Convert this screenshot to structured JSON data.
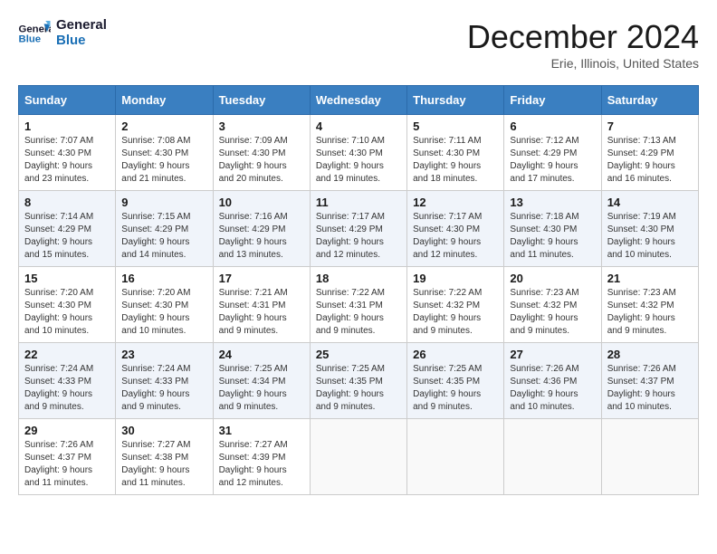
{
  "header": {
    "logo_line1": "General",
    "logo_line2": "Blue",
    "month_title": "December 2024",
    "location": "Erie, Illinois, United States"
  },
  "weekdays": [
    "Sunday",
    "Monday",
    "Tuesday",
    "Wednesday",
    "Thursday",
    "Friday",
    "Saturday"
  ],
  "weeks": [
    [
      {
        "day": "1",
        "sunrise": "7:07 AM",
        "sunset": "4:30 PM",
        "daylight": "9 hours and 23 minutes."
      },
      {
        "day": "2",
        "sunrise": "7:08 AM",
        "sunset": "4:30 PM",
        "daylight": "9 hours and 21 minutes."
      },
      {
        "day": "3",
        "sunrise": "7:09 AM",
        "sunset": "4:30 PM",
        "daylight": "9 hours and 20 minutes."
      },
      {
        "day": "4",
        "sunrise": "7:10 AM",
        "sunset": "4:30 PM",
        "daylight": "9 hours and 19 minutes."
      },
      {
        "day": "5",
        "sunrise": "7:11 AM",
        "sunset": "4:30 PM",
        "daylight": "9 hours and 18 minutes."
      },
      {
        "day": "6",
        "sunrise": "7:12 AM",
        "sunset": "4:29 PM",
        "daylight": "9 hours and 17 minutes."
      },
      {
        "day": "7",
        "sunrise": "7:13 AM",
        "sunset": "4:29 PM",
        "daylight": "9 hours and 16 minutes."
      }
    ],
    [
      {
        "day": "8",
        "sunrise": "7:14 AM",
        "sunset": "4:29 PM",
        "daylight": "9 hours and 15 minutes."
      },
      {
        "day": "9",
        "sunrise": "7:15 AM",
        "sunset": "4:29 PM",
        "daylight": "9 hours and 14 minutes."
      },
      {
        "day": "10",
        "sunrise": "7:16 AM",
        "sunset": "4:29 PM",
        "daylight": "9 hours and 13 minutes."
      },
      {
        "day": "11",
        "sunrise": "7:17 AM",
        "sunset": "4:29 PM",
        "daylight": "9 hours and 12 minutes."
      },
      {
        "day": "12",
        "sunrise": "7:17 AM",
        "sunset": "4:30 PM",
        "daylight": "9 hours and 12 minutes."
      },
      {
        "day": "13",
        "sunrise": "7:18 AM",
        "sunset": "4:30 PM",
        "daylight": "9 hours and 11 minutes."
      },
      {
        "day": "14",
        "sunrise": "7:19 AM",
        "sunset": "4:30 PM",
        "daylight": "9 hours and 10 minutes."
      }
    ],
    [
      {
        "day": "15",
        "sunrise": "7:20 AM",
        "sunset": "4:30 PM",
        "daylight": "9 hours and 10 minutes."
      },
      {
        "day": "16",
        "sunrise": "7:20 AM",
        "sunset": "4:30 PM",
        "daylight": "9 hours and 10 minutes."
      },
      {
        "day": "17",
        "sunrise": "7:21 AM",
        "sunset": "4:31 PM",
        "daylight": "9 hours and 9 minutes."
      },
      {
        "day": "18",
        "sunrise": "7:22 AM",
        "sunset": "4:31 PM",
        "daylight": "9 hours and 9 minutes."
      },
      {
        "day": "19",
        "sunrise": "7:22 AM",
        "sunset": "4:32 PM",
        "daylight": "9 hours and 9 minutes."
      },
      {
        "day": "20",
        "sunrise": "7:23 AM",
        "sunset": "4:32 PM",
        "daylight": "9 hours and 9 minutes."
      },
      {
        "day": "21",
        "sunrise": "7:23 AM",
        "sunset": "4:32 PM",
        "daylight": "9 hours and 9 minutes."
      }
    ],
    [
      {
        "day": "22",
        "sunrise": "7:24 AM",
        "sunset": "4:33 PM",
        "daylight": "9 hours and 9 minutes."
      },
      {
        "day": "23",
        "sunrise": "7:24 AM",
        "sunset": "4:33 PM",
        "daylight": "9 hours and 9 minutes."
      },
      {
        "day": "24",
        "sunrise": "7:25 AM",
        "sunset": "4:34 PM",
        "daylight": "9 hours and 9 minutes."
      },
      {
        "day": "25",
        "sunrise": "7:25 AM",
        "sunset": "4:35 PM",
        "daylight": "9 hours and 9 minutes."
      },
      {
        "day": "26",
        "sunrise": "7:25 AM",
        "sunset": "4:35 PM",
        "daylight": "9 hours and 9 minutes."
      },
      {
        "day": "27",
        "sunrise": "7:26 AM",
        "sunset": "4:36 PM",
        "daylight": "9 hours and 10 minutes."
      },
      {
        "day": "28",
        "sunrise": "7:26 AM",
        "sunset": "4:37 PM",
        "daylight": "9 hours and 10 minutes."
      }
    ],
    [
      {
        "day": "29",
        "sunrise": "7:26 AM",
        "sunset": "4:37 PM",
        "daylight": "9 hours and 11 minutes."
      },
      {
        "day": "30",
        "sunrise": "7:27 AM",
        "sunset": "4:38 PM",
        "daylight": "9 hours and 11 minutes."
      },
      {
        "day": "31",
        "sunrise": "7:27 AM",
        "sunset": "4:39 PM",
        "daylight": "9 hours and 12 minutes."
      },
      null,
      null,
      null,
      null
    ]
  ],
  "labels": {
    "sunrise": "Sunrise:",
    "sunset": "Sunset:",
    "daylight": "Daylight:"
  }
}
